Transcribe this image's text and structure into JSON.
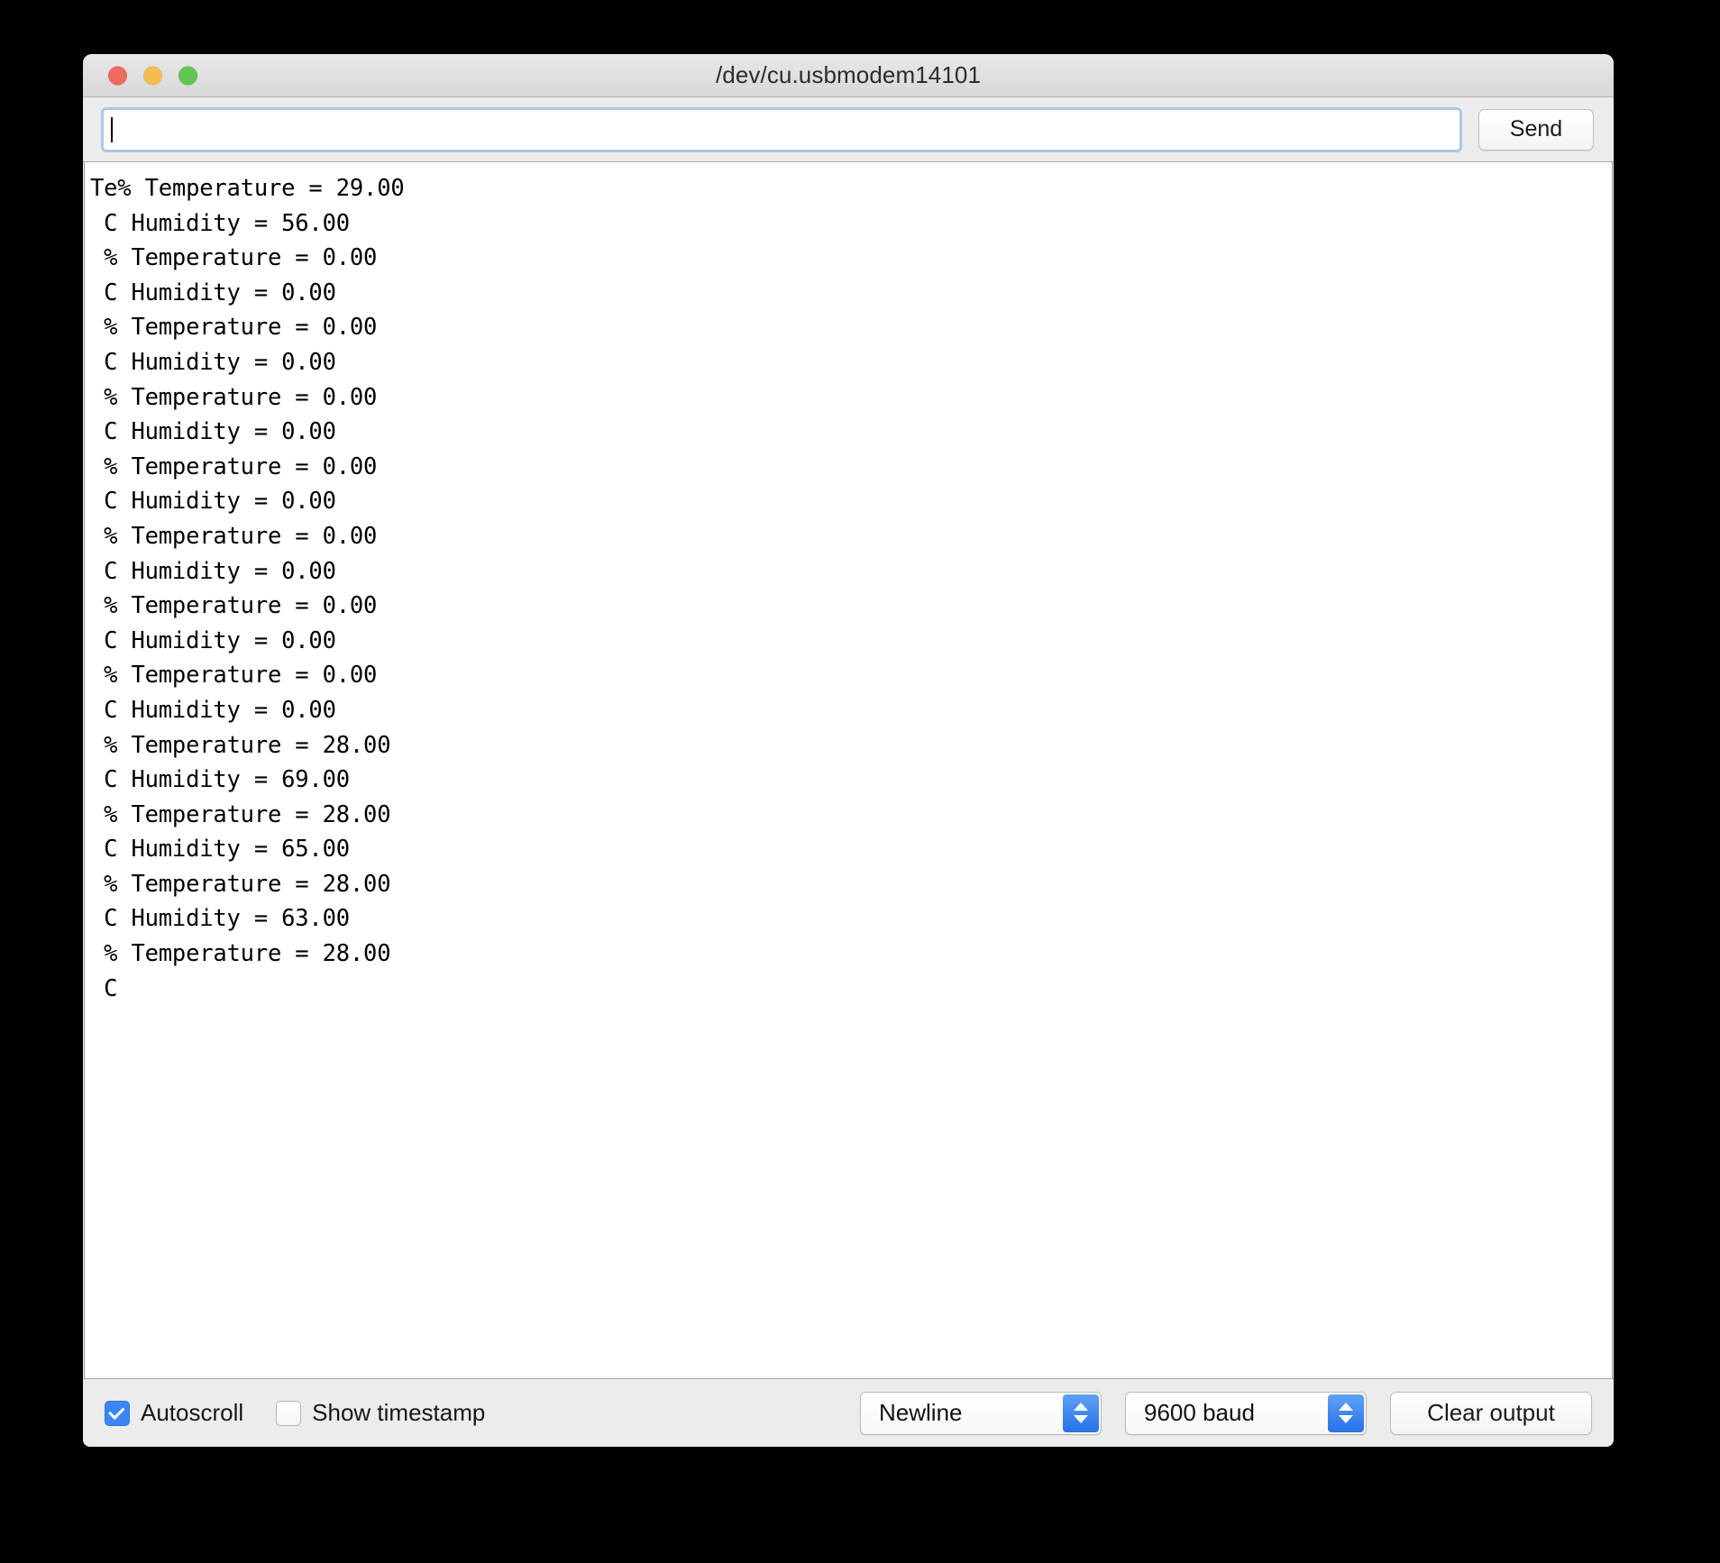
{
  "window": {
    "title": "/dev/cu.usbmodem14101",
    "traffic_lights": [
      {
        "name": "close",
        "color": "#ed6a5e"
      },
      {
        "name": "minimize",
        "color": "#f4bd4f"
      },
      {
        "name": "maximize",
        "color": "#61c454"
      }
    ]
  },
  "sendbar": {
    "input_value": "",
    "input_placeholder": "",
    "send_label": "Send"
  },
  "output": {
    "lines": [
      "Te% Temperature = 29.00",
      " C Humidity = 56.00",
      " % Temperature = 0.00",
      " C Humidity = 0.00",
      " % Temperature = 0.00",
      " C Humidity = 0.00",
      " % Temperature = 0.00",
      " C Humidity = 0.00",
      " % Temperature = 0.00",
      " C Humidity = 0.00",
      " % Temperature = 0.00",
      " C Humidity = 0.00",
      " % Temperature = 0.00",
      " C Humidity = 0.00",
      " % Temperature = 0.00",
      " C Humidity = 0.00",
      " % Temperature = 28.00",
      " C Humidity = 69.00",
      " % Temperature = 28.00",
      " C Humidity = 65.00",
      " % Temperature = 28.00",
      " C Humidity = 63.00",
      " % Temperature = 28.00",
      " C"
    ]
  },
  "bottombar": {
    "autoscroll_label": "Autoscroll",
    "autoscroll_checked": true,
    "timestamp_label": "Show timestamp",
    "timestamp_checked": false,
    "line_ending_value": "Newline",
    "baud_value": "9600 baud",
    "clear_label": "Clear output"
  },
  "colors": {
    "accent_blue": "#3b86f7",
    "stepper_blue": "#2472e8",
    "focus_ring": "#76a9e3",
    "window_chrome": "#ececec",
    "output_background": "#ffffff"
  }
}
